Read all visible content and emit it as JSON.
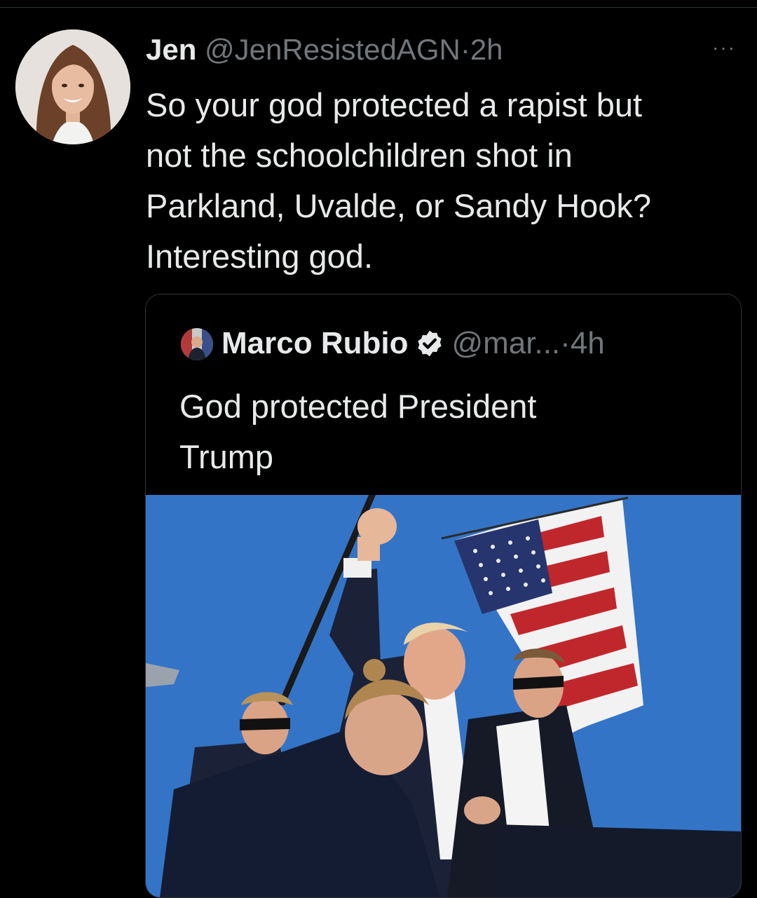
{
  "tweet": {
    "display_name": "Jen",
    "handle": "@JenResistedAGN",
    "separator": "·",
    "time": "2h",
    "more_label": "···",
    "text": "So your god protected a rapist but\nnot the schoolchildren shot in\nParkland, Uvalde, or Sandy Hook?\nInteresting god."
  },
  "quoted_tweet": {
    "display_name": "Marco Rubio",
    "verified": true,
    "handle": "@mar...",
    "separator": "·",
    "time": "4h",
    "text": "God protected President\nTrump",
    "media_icon": "photo-image"
  },
  "colors": {
    "background": "#000000",
    "text": "#e7e9ea",
    "muted": "#71767b",
    "border": "#2f3336",
    "sky": "#2f6fc2"
  }
}
